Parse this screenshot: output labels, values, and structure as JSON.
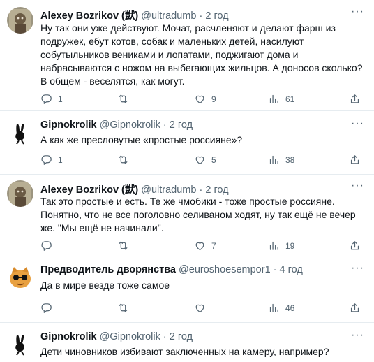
{
  "tweets": [
    {
      "name": "Alexey Bozrikov (獃)",
      "handle": "@ultradumb",
      "dot": "·",
      "time": "2 год",
      "text": "Ну так они уже действуют. Мочат, расчленяют и делают фарш из подружек, ебут котов, собак и маленьких детей, насилуют собутыльников вениками и лопатами, поджигают дома и набрасываются с ножом на выбегающих жильцов. А доносов сколько? В общем - веселятся, как могут.",
      "replies": "1",
      "retweets": "",
      "likes": "9",
      "views": "61"
    },
    {
      "name": "Gipnokrolik",
      "handle": "@Gipnokrolik",
      "dot": "·",
      "time": "2 год",
      "text": "А как же пресловутые «простые россияне»?",
      "replies": "1",
      "retweets": "",
      "likes": "5",
      "views": "38"
    },
    {
      "name": "Alexey Bozrikov (獃)",
      "handle": "@ultradumb",
      "dot": "·",
      "time": "2 год",
      "text": "Так это простые и есть. Те же чмобики - тоже простые россияне. Понятно, что не все поголовно селиваном ходят, ну так ещё не вечер же. \"Мы ещё не начинали\".",
      "replies": "",
      "retweets": "",
      "likes": "7",
      "views": "19"
    },
    {
      "name": "Предводитель дворянства",
      "handle": "@euroshoesempor1",
      "dot": "·",
      "time": "4 год",
      "text": "Да в мире везде тоже самое",
      "replies": "",
      "retweets": "",
      "likes": "",
      "views": "46"
    },
    {
      "name": "Gipnokrolik",
      "handle": "@Gipnokrolik",
      "dot": "·",
      "time": "2 год",
      "text": "Дети чиновников избивают заключенных на камеру, например?"
    }
  ],
  "more_label": "···",
  "icons": [
    "reply-icon",
    "retweet-icon",
    "like-icon",
    "views-icon",
    "share-icon",
    "more-icon"
  ],
  "colors": {
    "muted": "#536471",
    "text": "#0f1419",
    "divider": "#e6ecf0"
  }
}
